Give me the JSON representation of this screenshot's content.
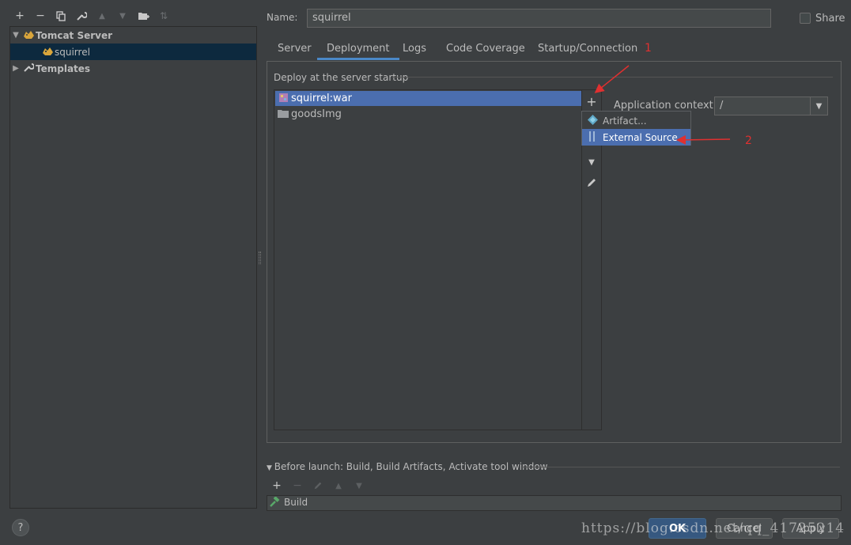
{
  "toolbar": {
    "add_icon": "plus-icon",
    "remove_icon": "minus-icon",
    "copy_icon": "copy-icon",
    "edit_icon": "wrench-icon",
    "up_icon": "arrow-up-icon",
    "down_icon": "arrow-down-icon",
    "folder_icon": "new-folder-icon",
    "sort_icon": "sort-icon"
  },
  "tree": {
    "group_label": "Tomcat Server",
    "child_label": "squirrel",
    "templates_label": "Templates"
  },
  "name": {
    "label": "Name:",
    "value": "squirrel"
  },
  "share": {
    "label": "Share",
    "checked": false
  },
  "tabs": [
    {
      "label": "Server",
      "active": false
    },
    {
      "label": "Deployment",
      "active": true
    },
    {
      "label": "Logs",
      "active": false
    },
    {
      "label": "Code Coverage",
      "active": false
    },
    {
      "label": "Startup/Connection",
      "active": false
    }
  ],
  "deployment": {
    "section_title": "Deploy at the server startup",
    "items": [
      {
        "label": "squirrel:war",
        "icon": "artifact-icon",
        "selected": true
      },
      {
        "label": "goodsImg",
        "icon": "folder-icon",
        "selected": false
      }
    ],
    "app_context_label": "Application context:",
    "app_context_value": "/"
  },
  "popup": {
    "items": [
      {
        "label": "Artifact...",
        "icon": "artifact-diamond-icon",
        "selected": false
      },
      {
        "label": "External Source...",
        "icon": "external-source-icon",
        "selected": true
      }
    ]
  },
  "annotations": {
    "marker_1": "1",
    "marker_2": "2",
    "color": "#e03030"
  },
  "before_launch": {
    "title": "Before launch: Build, Build Artifacts, Activate tool window",
    "items": [
      {
        "label": "Build",
        "icon": "hammer-icon"
      }
    ]
  },
  "buttons": {
    "help": "?",
    "ok": "OK",
    "cancel": "Cancel",
    "apply": "Apply"
  },
  "watermark": "https://blog.csdn.net/qq_41725214",
  "colors": {
    "background": "#3c3f41",
    "selection": "#4b6eaf",
    "tree_selection": "#0d293e",
    "accent": "#4a88c7"
  }
}
